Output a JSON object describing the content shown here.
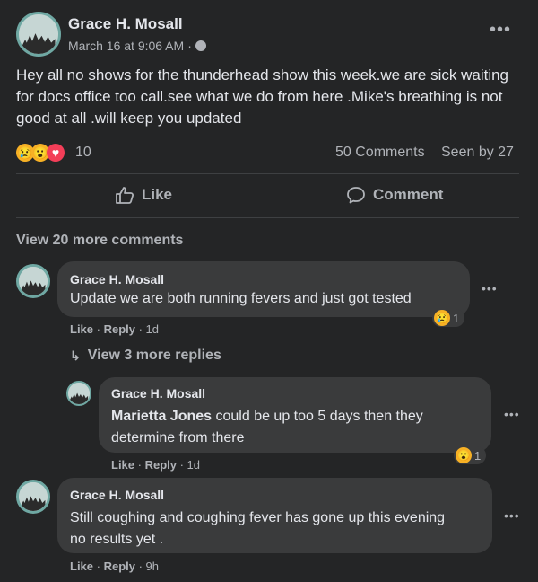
{
  "post": {
    "author": "Grace H. Mosall",
    "time": "March 16 at 9:06 AM",
    "separator": "·",
    "text": "Hey all no shows for the thunderhead show this week.we are sick waiting for docs office too call.see what we do from here .Mike's breathing is not good at all .will keep you updated",
    "reaction_count": "10",
    "comments_count": "50 Comments",
    "seen_by": "Seen by 27",
    "reactions": [
      "sad",
      "wow",
      "care"
    ]
  },
  "actions": {
    "like": "Like",
    "comment": "Comment"
  },
  "view_more_comments": "View 20 more comments",
  "comments": [
    {
      "author": "Grace H. Mosall",
      "text": "Update we are both running fevers and just got tested",
      "like": "Like",
      "reply": "Reply",
      "time": "1d",
      "reaction_count": "1",
      "reaction": "sad"
    },
    {
      "author": "Grace H. Mosall",
      "mention": "Marietta Jones",
      "text": " could be up too 5 days then they determine from there",
      "like": "Like",
      "reply": "Reply",
      "time": "1d",
      "reaction_count": "1",
      "reaction": "wow"
    },
    {
      "author": "Grace H. Mosall",
      "text": "Still coughing and coughing fever has gone up this evening no results yet .",
      "like": "Like",
      "reply": "Reply",
      "time": "9h"
    }
  ],
  "view_more_replies": "View 3 more replies",
  "colors": {
    "bg": "#242526",
    "bubble": "#3a3b3c",
    "text": "#e4e6eb",
    "muted": "#b0b3b8"
  }
}
